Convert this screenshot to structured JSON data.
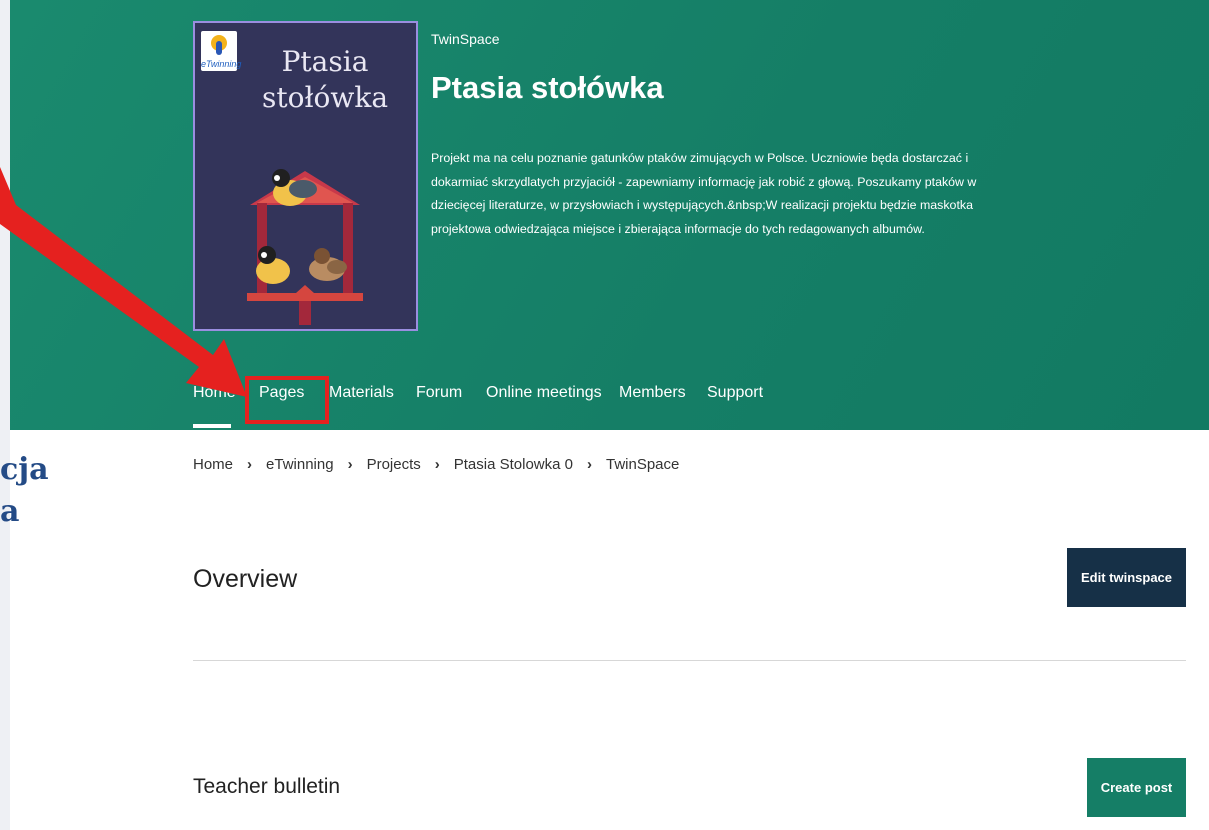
{
  "hero": {
    "cover": {
      "logo_text": "eTwinning",
      "title_line1": "Ptasia",
      "title_line2": "stołówka"
    },
    "label": "TwinSpace",
    "title": "Ptasia stołówka",
    "description": "Projekt ma na celu poznanie gatunków ptaków zimujących w Polsce. Uczniowie będa dostarczać i dokarmiać skrzydlatych przyjaciół - zapewniamy informację jak robić z głową. Poszukamy ptaków w dziecięcej literaturze, w przysłowiach i występujących.&nbsp;W realizacji projektu będzie maskotka projektowa odwiedzająca miejsce i zbierająca informacje do tych redagowanych albumów."
  },
  "tabs": [
    "Home",
    "Pages",
    "Materials",
    "Forum",
    "Online meetings",
    "Members",
    "Support"
  ],
  "breadcrumb": [
    "Home",
    "eTwinning",
    "Projects",
    "Ptasia Stolowka 0",
    "TwinSpace"
  ],
  "breadcrumb_separator": "›",
  "sections": {
    "overview": "Overview",
    "edit_button": "Edit twinspace",
    "teacher_bulletin": "Teacher bulletin",
    "create_post_button": "Create post"
  },
  "side_text": [
    "cja",
    "a"
  ],
  "colors": {
    "hero_bg": "#157e66",
    "dark_button": "#163047",
    "green_button": "#157e66",
    "highlight": "#e5211f"
  }
}
